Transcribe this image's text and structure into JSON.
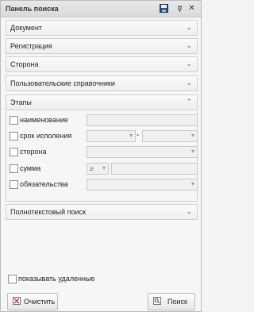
{
  "panel": {
    "title": "Панель поиска"
  },
  "sections": [
    {
      "label": "Документ"
    },
    {
      "label": "Регистрация"
    },
    {
      "label": "Сторона"
    },
    {
      "label": "Пользовательские справочники"
    },
    {
      "label": "Этапы"
    },
    {
      "label": "Полнотекстовый поиск"
    }
  ],
  "stage_fields": [
    {
      "label": "наименование"
    },
    {
      "label": "срок исполения",
      "dash": "-"
    },
    {
      "label": "сторона"
    },
    {
      "label": "сумма",
      "operator": "≥"
    },
    {
      "label": "обязательства"
    }
  ],
  "show_deleted": {
    "label": "показывать удаленные"
  },
  "buttons": {
    "clear": "Очистить",
    "search": "Поиск"
  }
}
